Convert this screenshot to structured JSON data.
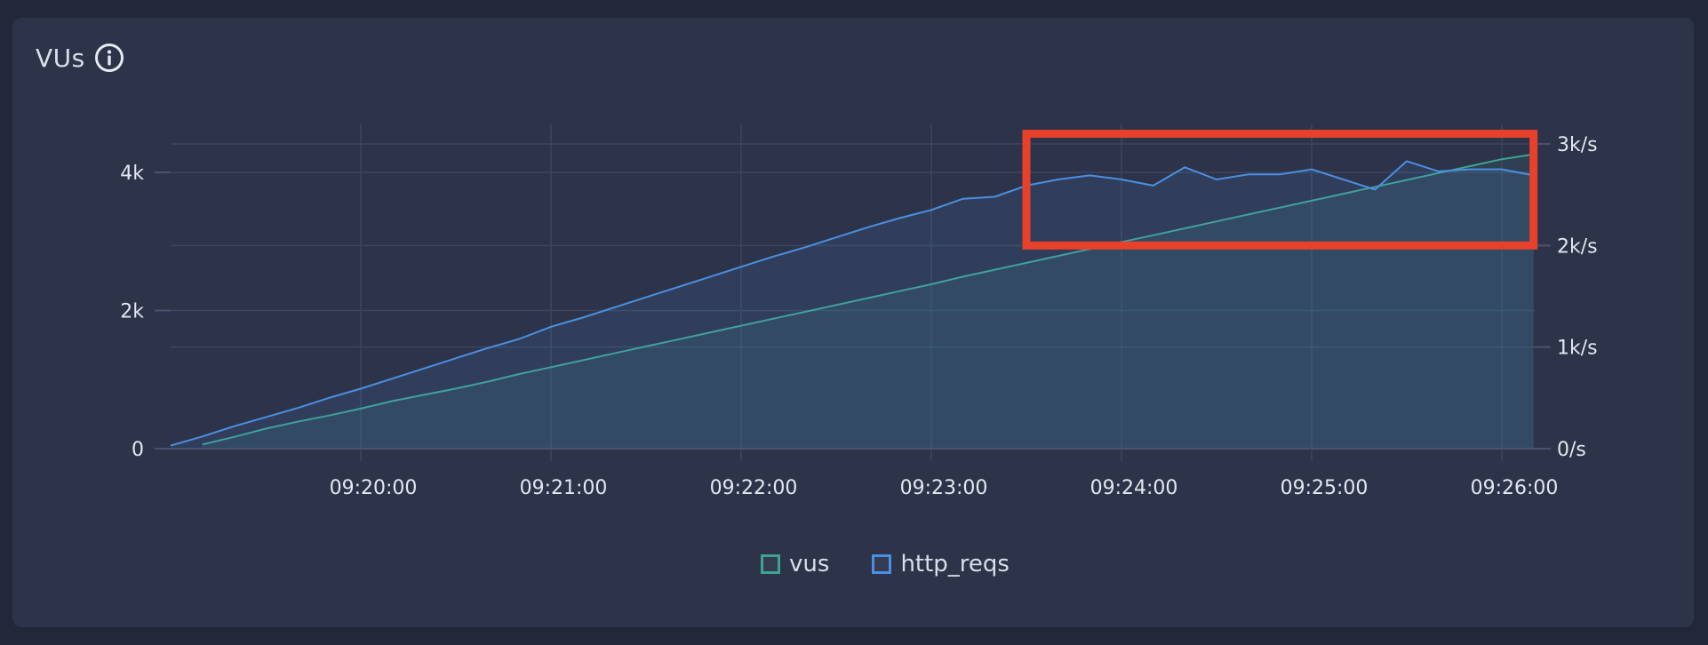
{
  "panel": {
    "title": "VUs",
    "info_icon": "info-circle-icon"
  },
  "colors": {
    "vus": "#3fa394",
    "http_reqs": "#4a90e2",
    "highlight": "#e8412b"
  },
  "chart_data": {
    "type": "line",
    "title": "VUs",
    "x_tick_labels": [
      "09:20:00",
      "09:21:00",
      "09:22:00",
      "09:23:00",
      "09:24:00",
      "09:25:00",
      "09:26:00"
    ],
    "left_axis": {
      "ticks": [
        0,
        2000,
        4000
      ],
      "tick_labels": [
        "0",
        "2k",
        "4k"
      ],
      "range": [
        0,
        4000
      ]
    },
    "right_axis": {
      "ticks": [
        0,
        1000,
        2000,
        3000
      ],
      "tick_labels": [
        "0/s",
        "1k/s",
        "2k/s",
        "3k/s"
      ],
      "range": [
        0,
        3000
      ]
    },
    "grid": true,
    "legend_position": "bottom-center",
    "series": [
      {
        "name": "vus",
        "axis": "left",
        "points": [
          [
            "09:19:10",
            60
          ],
          [
            "09:19:20",
            170
          ],
          [
            "09:19:30",
            290
          ],
          [
            "09:19:40",
            390
          ],
          [
            "09:19:50",
            480
          ],
          [
            "09:20:00",
            580
          ],
          [
            "09:20:10",
            690
          ],
          [
            "09:20:20",
            780
          ],
          [
            "09:20:30",
            870
          ],
          [
            "09:20:40",
            970
          ],
          [
            "09:20:50",
            1080
          ],
          [
            "09:21:00",
            1180
          ],
          [
            "09:21:10",
            1280
          ],
          [
            "09:21:20",
            1380
          ],
          [
            "09:21:30",
            1480
          ],
          [
            "09:21:40",
            1580
          ],
          [
            "09:21:50",
            1680
          ],
          [
            "09:22:00",
            1780
          ],
          [
            "09:22:10",
            1880
          ],
          [
            "09:22:20",
            1980
          ],
          [
            "09:22:30",
            2080
          ],
          [
            "09:22:40",
            2180
          ],
          [
            "09:22:50",
            2280
          ],
          [
            "09:23:00",
            2380
          ],
          [
            "09:23:10",
            2490
          ],
          [
            "09:23:20",
            2590
          ],
          [
            "09:23:30",
            2690
          ],
          [
            "09:23:40",
            2790
          ],
          [
            "09:23:50",
            2890
          ],
          [
            "09:24:00",
            2990
          ],
          [
            "09:24:10",
            3090
          ],
          [
            "09:24:20",
            3190
          ],
          [
            "09:24:30",
            3290
          ],
          [
            "09:24:40",
            3390
          ],
          [
            "09:24:50",
            3490
          ],
          [
            "09:25:00",
            3590
          ],
          [
            "09:25:10",
            3690
          ],
          [
            "09:25:20",
            3790
          ],
          [
            "09:25:30",
            3890
          ],
          [
            "09:25:40",
            3990
          ],
          [
            "09:25:50",
            4090
          ],
          [
            "09:26:00",
            4190
          ],
          [
            "09:26:10",
            4260
          ]
        ]
      },
      {
        "name": "http_reqs",
        "axis": "right",
        "points": [
          [
            "09:19:00",
            30
          ],
          [
            "09:19:10",
            120
          ],
          [
            "09:19:20",
            220
          ],
          [
            "09:19:30",
            310
          ],
          [
            "09:19:40",
            400
          ],
          [
            "09:19:50",
            500
          ],
          [
            "09:20:00",
            590
          ],
          [
            "09:20:10",
            690
          ],
          [
            "09:20:20",
            790
          ],
          [
            "09:20:30",
            890
          ],
          [
            "09:20:40",
            990
          ],
          [
            "09:20:50",
            1080
          ],
          [
            "09:21:00",
            1200
          ],
          [
            "09:21:10",
            1290
          ],
          [
            "09:21:20",
            1390
          ],
          [
            "09:21:30",
            1490
          ],
          [
            "09:21:40",
            1590
          ],
          [
            "09:21:50",
            1690
          ],
          [
            "09:22:00",
            1790
          ],
          [
            "09:22:10",
            1890
          ],
          [
            "09:22:20",
            1980
          ],
          [
            "09:22:30",
            2080
          ],
          [
            "09:22:40",
            2180
          ],
          [
            "09:22:50",
            2270
          ],
          [
            "09:23:00",
            2350
          ],
          [
            "09:23:10",
            2460
          ],
          [
            "09:23:20",
            2480
          ],
          [
            "09:23:30",
            2590
          ],
          [
            "09:23:40",
            2650
          ],
          [
            "09:23:50",
            2690
          ],
          [
            "09:24:00",
            2650
          ],
          [
            "09:24:10",
            2590
          ],
          [
            "09:24:20",
            2770
          ],
          [
            "09:24:30",
            2650
          ],
          [
            "09:24:40",
            2700
          ],
          [
            "09:24:50",
            2700
          ],
          [
            "09:25:00",
            2750
          ],
          [
            "09:25:10",
            2650
          ],
          [
            "09:25:20",
            2550
          ],
          [
            "09:25:30",
            2830
          ],
          [
            "09:25:40",
            2730
          ],
          [
            "09:25:50",
            2750
          ],
          [
            "09:26:00",
            2750
          ],
          [
            "09:26:10",
            2690
          ]
        ]
      }
    ],
    "highlight_box": {
      "x_start": "09:23:30",
      "x_end": "09:26:10",
      "right_axis_from": 2000,
      "right_axis_to": 3100
    }
  },
  "legend": [
    {
      "name": "vus",
      "color_key": "vus"
    },
    {
      "name": "http_reqs",
      "color_key": "http_reqs"
    }
  ]
}
